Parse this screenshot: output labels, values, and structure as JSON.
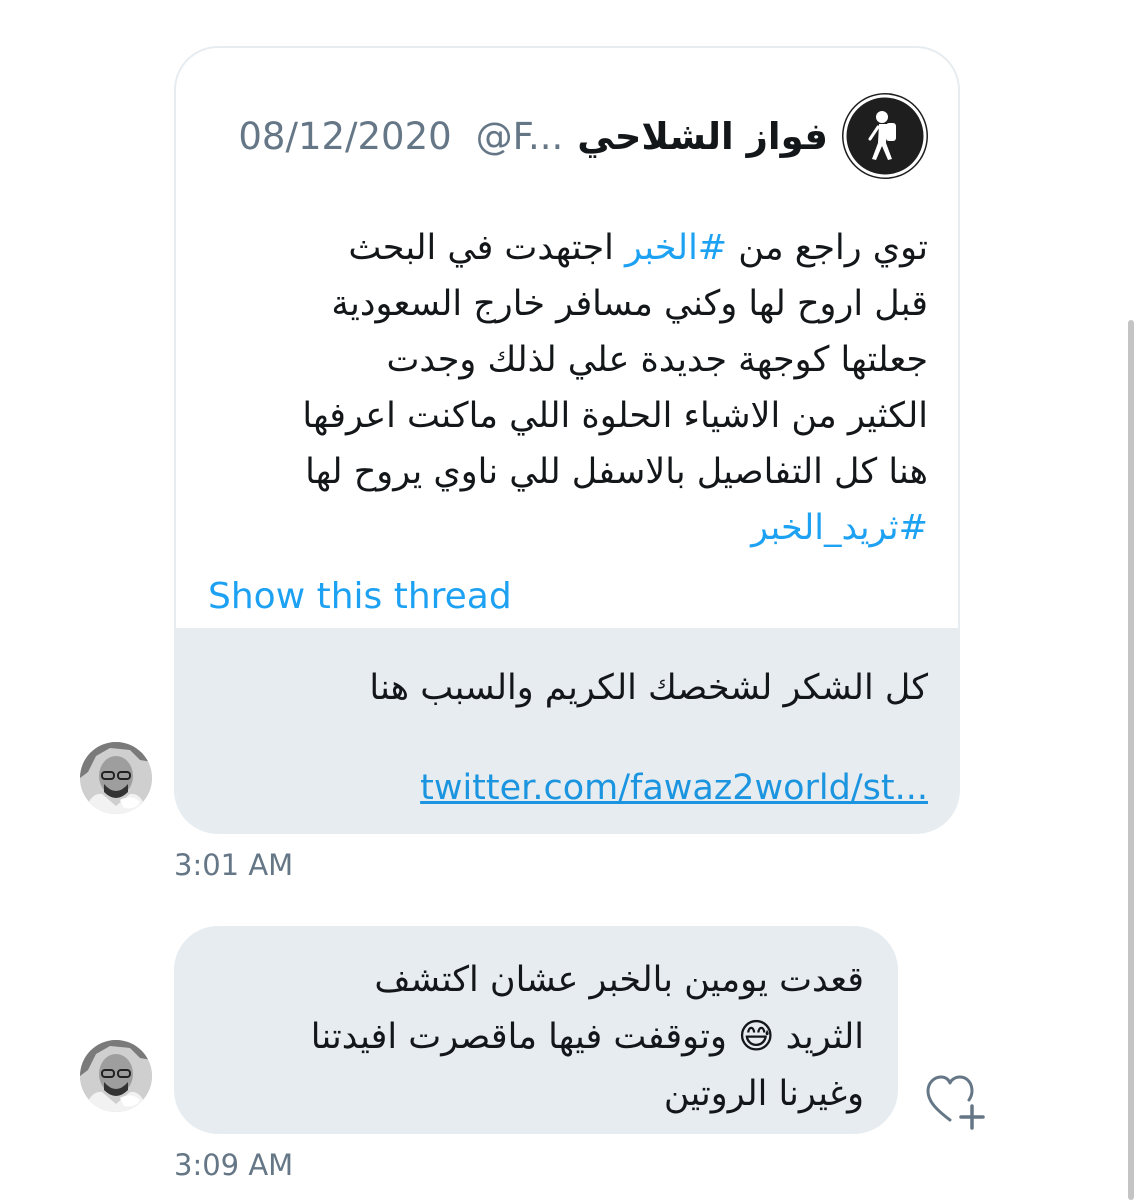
{
  "quoted_tweet": {
    "author_name": "فواز الشلاحي",
    "handle": "@F...",
    "date": "08/12/2020",
    "text_lines": {
      "l1_start": "توي راجع من ",
      "l1_hashtag": "#الخبر",
      "l1_end": " اجتهدت في البحث",
      "l2": "قبل اروح لها وكني مسافر خارج السعودية",
      "l3": "جعلتها كوجهة جديدة علي لذلك وجدت",
      "l4": "الكثير من الاشياء الحلوة اللي ماكنت اعرفها",
      "l5": "هنا كل التفاصيل بالاسفل للي ناوي يروح لها"
    },
    "hashtag_line": "#ثريد_الخبر",
    "show_thread": "Show this thread"
  },
  "message_1": {
    "text": "كل الشكر لشخصك الكريم والسبب هنا",
    "link": "twitter.com/fawaz2world/st...",
    "time": "3:01 AM"
  },
  "message_2": {
    "text": "قعدت يومين بالخبر عشان اكتشف\nالثريد 😅 وتوقفت فيها ماقصرت افيدتنا\nوغيرنا الروتين",
    "time": "3:09 AM"
  },
  "icons": {
    "like": "heart-plus-icon",
    "author_avatar": "hiker-avatar",
    "sender_avatar": "user-photo-avatar"
  },
  "colors": {
    "link_blue": "#1da1f2",
    "bubble_gray": "#e6ecf0",
    "meta_gray": "#657786"
  }
}
